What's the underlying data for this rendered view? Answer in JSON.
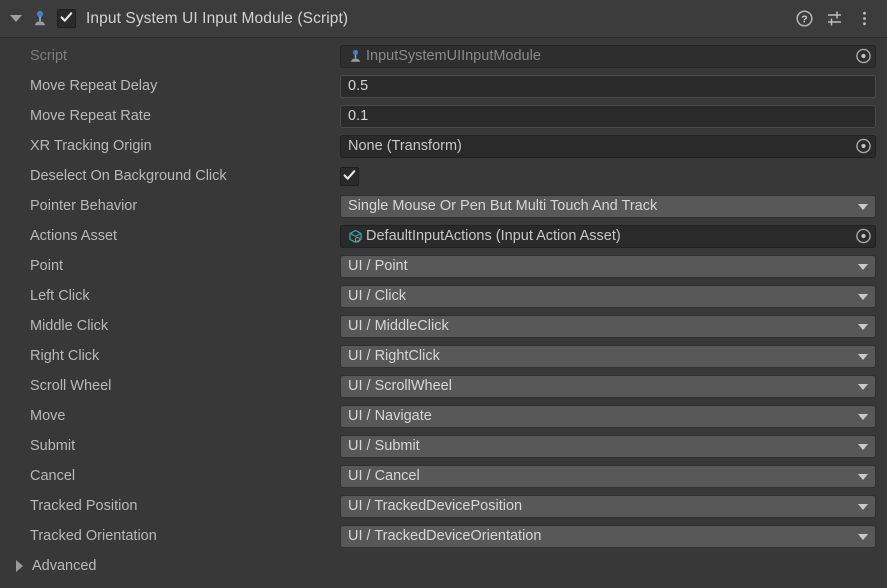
{
  "header": {
    "foldout_icon": "triangle-down-icon",
    "component_icon": "input-module-joystick-icon",
    "enabled": true,
    "enabled_icon": "checkmark-icon",
    "title": "Input System UI Input Module (Script)",
    "buttons": [
      {
        "name": "help-button",
        "icon": "help-question-icon",
        "label": "?"
      },
      {
        "name": "preset-button",
        "icon": "preset-sliders-icon",
        "label": ""
      },
      {
        "name": "context-menu-button",
        "icon": "kebab-menu-icon",
        "label": ""
      }
    ]
  },
  "colors": {
    "window_bg": "#383838",
    "header_bg": "#3c3c3c",
    "label_text": "#b9b9b9",
    "label_disabled": "#7d7d7d",
    "input_bg": "#2a2a2a",
    "popup_bg": "#585858",
    "accent_blue": "#3b7fd4",
    "asset_icon_teal": "#2ba6b5",
    "asset_icon_orange": "#d4732a"
  },
  "rows": [
    {
      "name": "script",
      "label": "Script",
      "label_disabled": true,
      "control": "object",
      "value": "InputSystemUIInputModule",
      "icon": "script-joystick-icon",
      "picker_icon": "object-picker-icon",
      "interactable": false
    },
    {
      "name": "move-repeat-delay",
      "label": "Move Repeat Delay",
      "control": "number",
      "value": "0.5"
    },
    {
      "name": "move-repeat-rate",
      "label": "Move Repeat Rate",
      "control": "number",
      "value": "0.1"
    },
    {
      "name": "xr-tracking-origin",
      "label": "XR Tracking Origin",
      "control": "object",
      "value": "None (Transform)",
      "icon": "",
      "picker_icon": "object-picker-icon",
      "interactable": true
    },
    {
      "name": "deselect-on-background-click",
      "label": "Deselect On Background Click",
      "control": "bool",
      "value": true,
      "icon": "checkmark-icon"
    },
    {
      "name": "pointer-behavior",
      "label": "Pointer Behavior",
      "control": "popup",
      "value": "Single Mouse Or Pen But Multi Touch And Track"
    },
    {
      "name": "actions-asset",
      "label": "Actions Asset",
      "control": "object",
      "value": "DefaultInputActions (Input Action Asset)",
      "icon": "input-action-asset-icon",
      "picker_icon": "object-picker-icon",
      "interactable": true
    },
    {
      "name": "point",
      "label": "Point",
      "control": "popup",
      "value": "UI / Point"
    },
    {
      "name": "left-click",
      "label": "Left Click",
      "control": "popup",
      "value": "UI / Click"
    },
    {
      "name": "middle-click",
      "label": "Middle Click",
      "control": "popup",
      "value": "UI / MiddleClick"
    },
    {
      "name": "right-click",
      "label": "Right Click",
      "control": "popup",
      "value": "UI / RightClick"
    },
    {
      "name": "scroll-wheel",
      "label": "Scroll Wheel",
      "control": "popup",
      "value": "UI / ScrollWheel"
    },
    {
      "name": "move",
      "label": "Move",
      "control": "popup",
      "value": "UI / Navigate"
    },
    {
      "name": "submit",
      "label": "Submit",
      "control": "popup",
      "value": "UI / Submit"
    },
    {
      "name": "cancel",
      "label": "Cancel",
      "control": "popup",
      "value": "UI / Cancel"
    },
    {
      "name": "tracked-position",
      "label": "Tracked Position",
      "control": "popup",
      "value": "UI / TrackedDevicePosition"
    },
    {
      "name": "tracked-orientation",
      "label": "Tracked Orientation",
      "control": "popup",
      "value": "UI / TrackedDeviceOrientation"
    }
  ],
  "advanced": {
    "label": "Advanced",
    "expanded": false,
    "icon": "triangle-right-icon"
  }
}
